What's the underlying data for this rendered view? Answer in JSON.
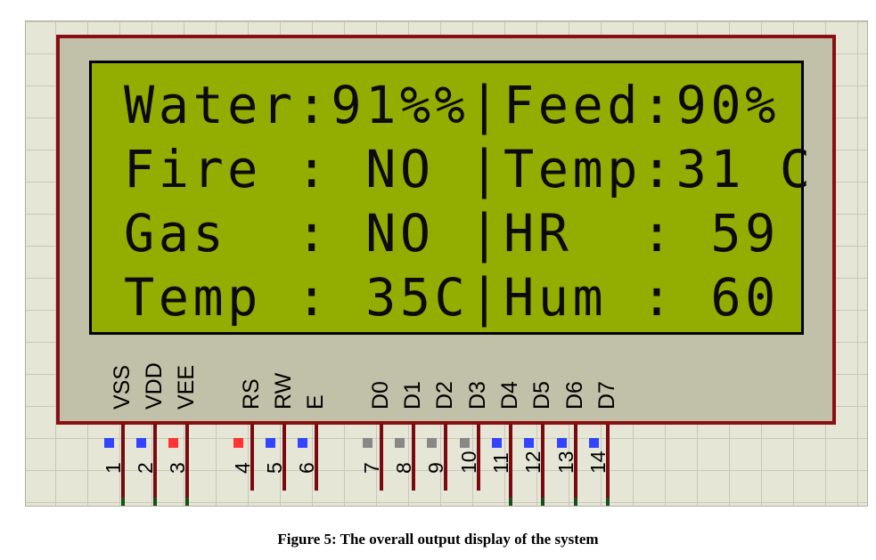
{
  "lcd": {
    "rows": [
      "Water:91%%|Feed:90%",
      "Fire : NO |Temp:31 C",
      "Gas  : NO |HR  : 59",
      "Temp : 35C|Hum : 60"
    ]
  },
  "pins": [
    {
      "num": "1",
      "label": "VSS",
      "color": "#3344ff"
    },
    {
      "num": "2",
      "label": "VDD",
      "color": "#3344ff"
    },
    {
      "num": "3",
      "label": "VEE",
      "color": "#ff3333"
    },
    {
      "num": "4",
      "label": "RS",
      "color": "#ff3333"
    },
    {
      "num": "5",
      "label": "RW",
      "color": "#3344ff"
    },
    {
      "num": "6",
      "label": "E",
      "color": "#3344ff"
    },
    {
      "num": "7",
      "label": "D0",
      "color": "#888888"
    },
    {
      "num": "8",
      "label": "D1",
      "color": "#888888"
    },
    {
      "num": "9",
      "label": "D2",
      "color": "#888888"
    },
    {
      "num": "10",
      "label": "D3",
      "color": "#888888"
    },
    {
      "num": "11",
      "label": "D4",
      "color": "#3344ff"
    },
    {
      "num": "12",
      "label": "D5",
      "color": "#3344ff"
    },
    {
      "num": "13",
      "label": "D6",
      "color": "#3344ff"
    },
    {
      "num": "14",
      "label": "D7",
      "color": "#3344ff"
    }
  ],
  "caption": "Figure 5: The overall output display of the system",
  "colors": {
    "lcd_background": "#93ad00",
    "frame": "#8b0f10",
    "grid": "#e6e6d6"
  }
}
